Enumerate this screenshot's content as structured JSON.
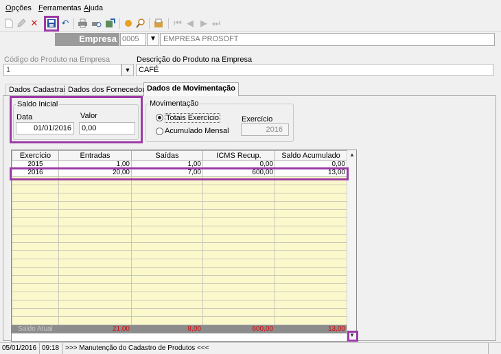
{
  "menu": {
    "items": [
      {
        "label": "Opções",
        "underline": "O"
      },
      {
        "label": "Ferramentas",
        "underline": "F"
      },
      {
        "label": "Ajuda",
        "underline": "A"
      }
    ]
  },
  "toolbar": {
    "buttons": [
      "new-document-icon",
      "edit-pencil-icon",
      "delete-x-icon",
      "save-floppy-icon",
      "undo-icon",
      "print-icon",
      "print-preview-icon",
      "export-icon",
      "pointer-icon",
      "search-icon",
      "attach-icon",
      "first-record-icon",
      "previous-record-icon",
      "next-record-icon",
      "last-record-icon"
    ]
  },
  "empresa": {
    "label": "Empresa",
    "code": "0005",
    "name": "EMPRESA PROSOFT"
  },
  "produto": {
    "codigo_label": "Código do Produto na Empresa",
    "codigo_value": "1",
    "descricao_label": "Descrição do Produto na Empresa",
    "descricao_value": "CAFÉ"
  },
  "tabs": [
    {
      "label": "Dados Cadastrais",
      "active": false
    },
    {
      "label": "Dados dos Fornecedores",
      "active": false
    },
    {
      "label": "Dados de Movimentação",
      "active": true
    }
  ],
  "saldo_inicial": {
    "legend": "Saldo Inicial",
    "data_label": "Data",
    "data_value": "01/01/2016",
    "valor_label": "Valor",
    "valor_value": "0,00"
  },
  "movimentacao": {
    "legend": "Movimentação",
    "opt1": "Totais Exercício",
    "opt2": "Acumulado Mensal",
    "selected": "opt1",
    "exercicio_label": "Exercício",
    "exercicio_value": "2016"
  },
  "grid": {
    "headers": [
      "Exercício",
      "Entradas",
      "Saídas",
      "ICMS Recup.",
      "Saldo Acumulado"
    ],
    "rows": [
      [
        "2015",
        "1,00",
        "1,00",
        "0,00",
        "0,00"
      ],
      [
        "2016",
        "20,00",
        "7,00",
        "600,00",
        "13,00"
      ]
    ],
    "summary": [
      "Saldo Atual",
      "21,00",
      "8,00",
      "600,00",
      "13,00"
    ]
  },
  "status": {
    "date": "05/01/2016",
    "time": "09:18",
    "message": ">>> Manutenção do Cadastro de Produtos <<<"
  },
  "colors": {
    "highlight": "#9b3aa6",
    "grid_filler": "#fbf8cc",
    "summary_text": "#e00000"
  }
}
